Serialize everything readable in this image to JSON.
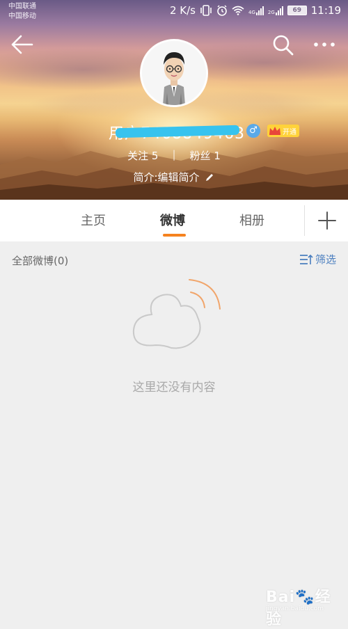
{
  "status_bar": {
    "carrier_1": "中国联通",
    "carrier_2": "中国移动",
    "speed": "2 K/s",
    "network_1": "4G",
    "network_2": "2G",
    "battery": "69",
    "time": "11:19"
  },
  "profile": {
    "name": "用户7468849463",
    "follow_label": "关注",
    "follow_count": "5",
    "fans_label": "粉丝",
    "fans_count": "1",
    "bio": "简介:编辑简介",
    "vip_label": "开通",
    "gender_symbol": "♂"
  },
  "tabs": [
    {
      "label": "主页"
    },
    {
      "label": "微博"
    },
    {
      "label": "相册"
    }
  ],
  "active_tab": "微博",
  "feed": {
    "all_label": "全部微博(0)",
    "filter_label": "筛选",
    "empty_text": "这里还没有内容"
  },
  "watermark": {
    "logo": "Bai",
    "logo_suffix": "经验",
    "url": "jingyan.baidu.com"
  },
  "colors": {
    "accent": "#f5821f",
    "link": "#4a7ebf",
    "vip": "#ffd23a",
    "gender": "#5aa9e8"
  }
}
